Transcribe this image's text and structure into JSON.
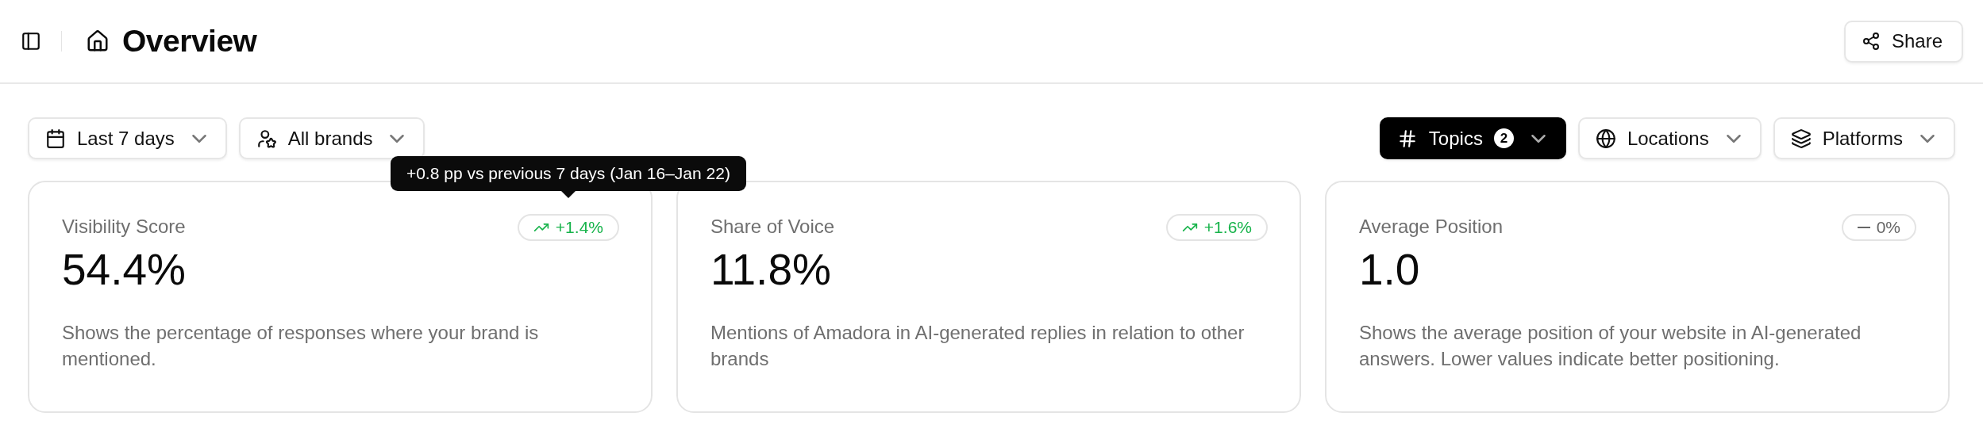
{
  "header": {
    "title": "Overview",
    "share_button": "Share"
  },
  "filters_left": [
    {
      "kind": "calendar",
      "label": "Last 7 days"
    },
    {
      "kind": "brands",
      "label": "All brands"
    }
  ],
  "filters_right": [
    {
      "kind": "hash",
      "label": "Topics",
      "count": "2",
      "selected": true
    },
    {
      "kind": "globe",
      "label": "Locations",
      "selected": false
    },
    {
      "kind": "layers",
      "label": "Platforms",
      "selected": false
    }
  ],
  "cards": [
    {
      "label": "Visibility Score",
      "value": "54.4%",
      "trend": {
        "kind": "up",
        "text": "+1.4%"
      },
      "tooltip": "+0.8 pp vs previous 7 days (Jan 16–Jan 22)",
      "description": "Shows the percentage of responses where your brand is mentioned."
    },
    {
      "label": "Share of Voice",
      "value": "11.8%",
      "trend": {
        "kind": "up",
        "text": "+1.6%"
      },
      "description": "Mentions of Amadora in AI-generated replies in relation to other brands"
    },
    {
      "label": "Average Position",
      "value": "1.0",
      "trend": {
        "kind": "flat",
        "text": "0%"
      },
      "description": "Shows the average position of your website in AI-generated answers. Lower values indicate better positioning."
    }
  ]
}
